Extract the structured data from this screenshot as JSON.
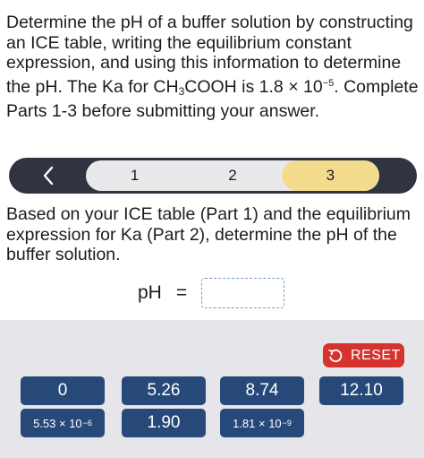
{
  "question": {
    "line1": "Determine the pH of a buffer solution by constructing an ICE table, writing the equilibrium constant expression, and using this information to determine the pH. The Ka for CH",
    "sub1": "3",
    "line2": "COOH is 1.8 ×",
    "line3_base": "10",
    "line3_exp": "−5",
    "line4": ". Complete Parts 1-3 before submitting your answer."
  },
  "stepper": {
    "parts": [
      "1",
      "2",
      "3"
    ],
    "active_index": 2,
    "active_color": "#f4dc8f"
  },
  "part_question": "Based on your ICE table (Part 1) and the equilibrium expression for Ka (Part 2), determine the pH of the buffer solution.",
  "answer": {
    "label": "pH",
    "equals": "=",
    "value": ""
  },
  "keypad": {
    "reset_label": "RESET",
    "reset_color": "#d6332f",
    "key_color": "#26497a",
    "keys": {
      "k1": "0",
      "k2": "5.26",
      "k3": "8.74",
      "k4": "12.10",
      "k5_base": "5.53 × 10",
      "k5_exp": "−6",
      "k6": "1.90",
      "k7_base": "1.81 × 10",
      "k7_exp": "−9"
    }
  }
}
